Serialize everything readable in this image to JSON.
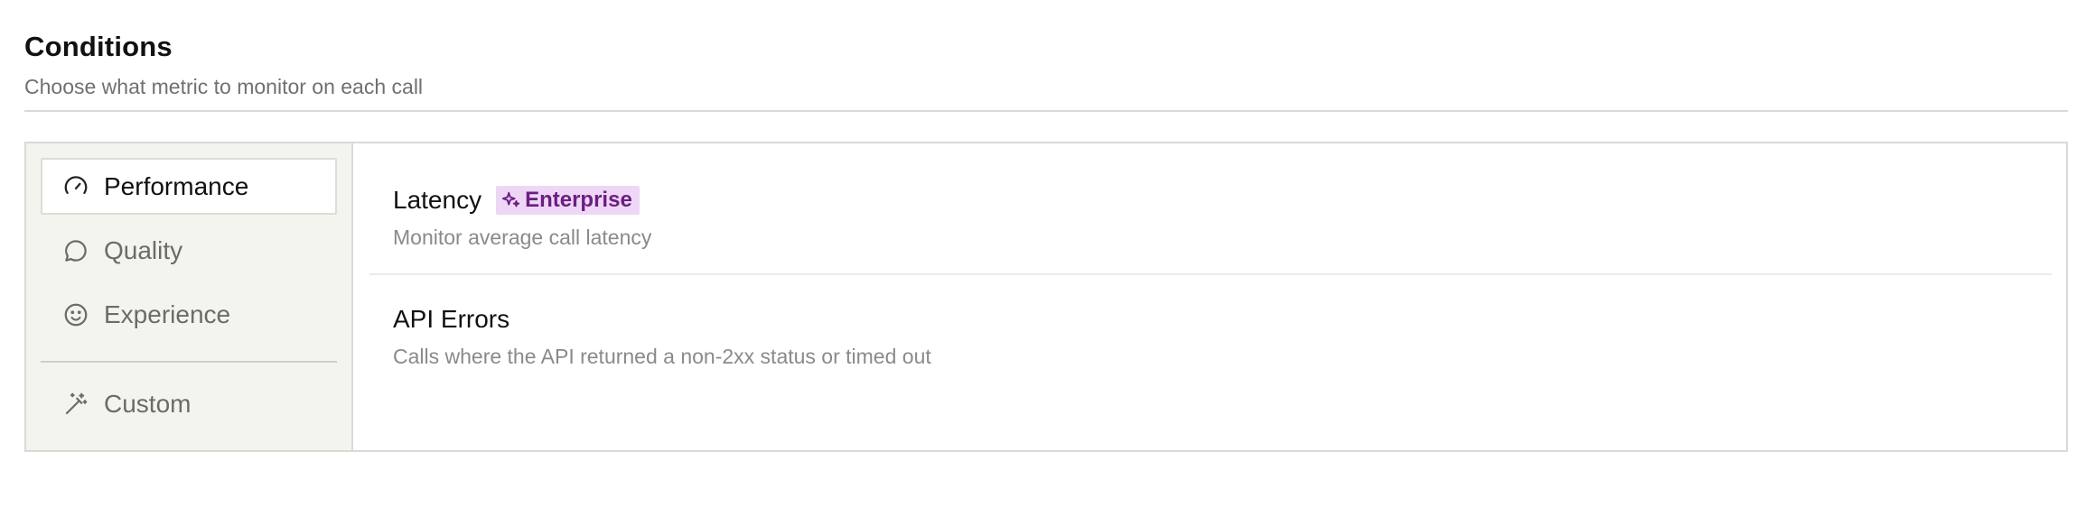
{
  "header": {
    "title": "Conditions",
    "subtitle": "Choose what metric to monitor on each call"
  },
  "sidebar": {
    "items": [
      {
        "label": "Performance",
        "icon": "gauge-icon",
        "active": true
      },
      {
        "label": "Quality",
        "icon": "chat-bubble-icon",
        "active": false
      },
      {
        "label": "Experience",
        "icon": "smiley-icon",
        "active": false
      },
      {
        "label": "Custom",
        "icon": "magic-wand-icon",
        "active": false
      }
    ]
  },
  "conditions": [
    {
      "title": "Latency",
      "badge": "Enterprise",
      "badge_icon": "sparkle-icon",
      "description": "Monitor average call latency"
    },
    {
      "title": "API Errors",
      "description": "Calls where the API returned a non-2xx status or timed out"
    }
  ],
  "colors": {
    "sidebar_bg": "#f4f4ee",
    "badge_bg": "#eed6f5",
    "badge_text": "#6b1e82",
    "muted_text": "#707070"
  }
}
